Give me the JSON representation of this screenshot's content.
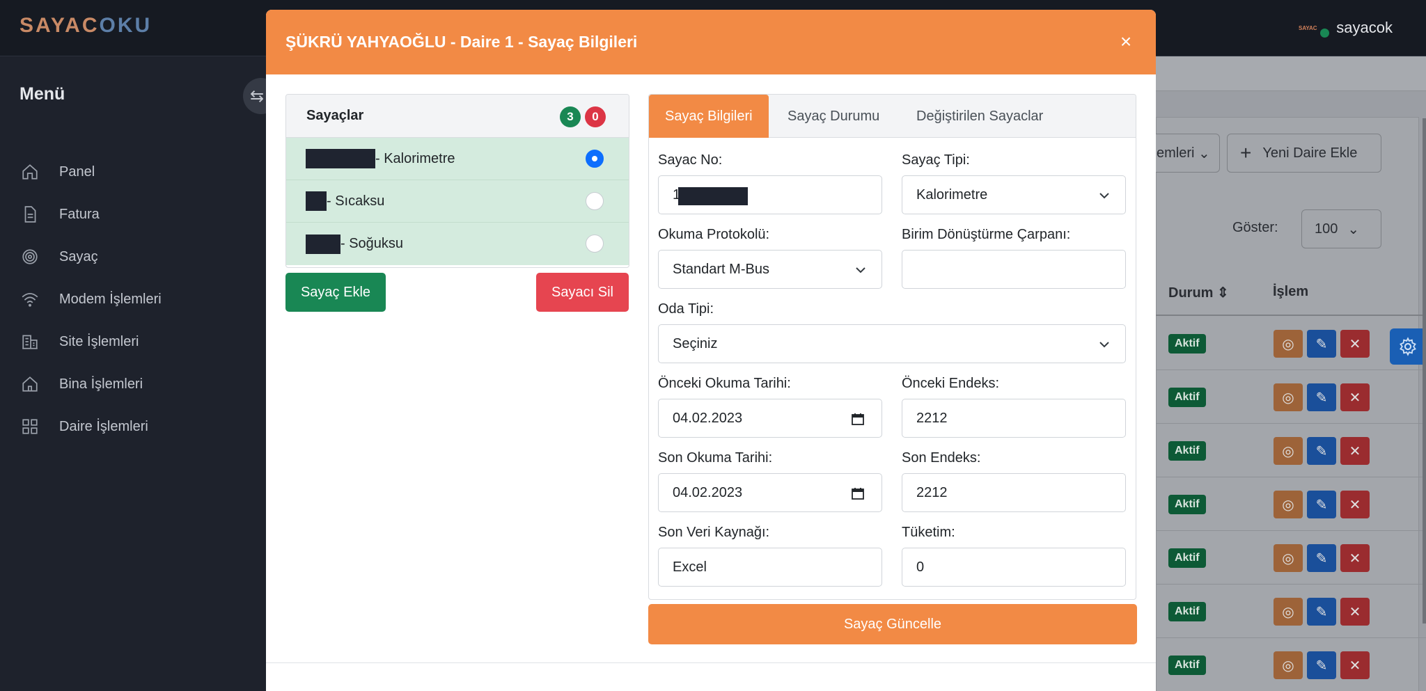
{
  "app": {
    "logo_part1": "SAYAC",
    "logo_part2": "OKU",
    "user_logo": "SAYAC",
    "username": "sayacok"
  },
  "sidebar": {
    "title": "Menü",
    "items": [
      {
        "label": "Panel",
        "icon": "home-icon"
      },
      {
        "label": "Fatura",
        "icon": "document-icon"
      },
      {
        "label": "Sayaç",
        "icon": "fingerprint-icon"
      },
      {
        "label": "Modem İşlemleri",
        "icon": "wifi-icon"
      },
      {
        "label": "Site İşlemleri",
        "icon": "buildings-icon"
      },
      {
        "label": "Bina İşlemleri",
        "icon": "house-icon"
      },
      {
        "label": "Daire İşlemleri",
        "icon": "grid-icon"
      }
    ]
  },
  "background_page": {
    "dropdown_label": "emleri",
    "add_button": "Yeni Daire Ekle",
    "show_label": "Göster:",
    "show_value": "100",
    "col_durum": "Durum",
    "col_islem": "İşlem",
    "rows": [
      {
        "status": "Aktif"
      },
      {
        "status": "Aktif"
      },
      {
        "status": "Aktif"
      },
      {
        "status": "Aktif"
      },
      {
        "status": "Aktif"
      },
      {
        "status": "Aktif"
      },
      {
        "status": "Aktif"
      }
    ]
  },
  "modal": {
    "title": "ŞÜKRÜ YAHYAOĞLU - Daire 1 - Sayaç Bilgileri",
    "close": "×",
    "meters": {
      "title": "Sayaçlar",
      "count_active": "3",
      "count_passive": "0",
      "items": [
        {
          "label": "- Kalorimetre",
          "selected": true
        },
        {
          "label": "- Sıcaksu",
          "selected": false
        },
        {
          "label": "- Soğuksu",
          "selected": false
        }
      ],
      "add_button": "Sayaç Ekle",
      "delete_button": "Sayacı Sil"
    },
    "tabs": [
      "Sayaç Bilgileri",
      "Sayaç Durumu",
      "Değiştirilen Sayaclar"
    ],
    "form": {
      "meter_no_label": "Sayac No:",
      "meter_no_value": "1",
      "meter_type_label": "Sayaç Tipi:",
      "meter_type_value": "Kalorimetre",
      "protocol_label": "Okuma Protokolü:",
      "protocol_value": "Standart M-Bus",
      "multiplier_label": "Birim Dönüştürme Çarpanı:",
      "multiplier_value": "",
      "room_type_label": "Oda Tipi:",
      "room_type_value": "Seçiniz",
      "prev_date_label": "Önceki Okuma Tarihi:",
      "prev_date_value": "04.02.2023",
      "prev_index_label": "Önceki Endeks:",
      "prev_index_value": "2212",
      "last_date_label": "Son Okuma Tarihi:",
      "last_date_value": "04.02.2023",
      "last_index_label": "Son Endeks:",
      "last_index_value": "2212",
      "source_label": "Son Veri Kaynağı:",
      "source_value": "Excel",
      "consumption_label": "Tüketim:",
      "consumption_value": "0"
    },
    "update_button": "Sayaç Güncelle"
  }
}
